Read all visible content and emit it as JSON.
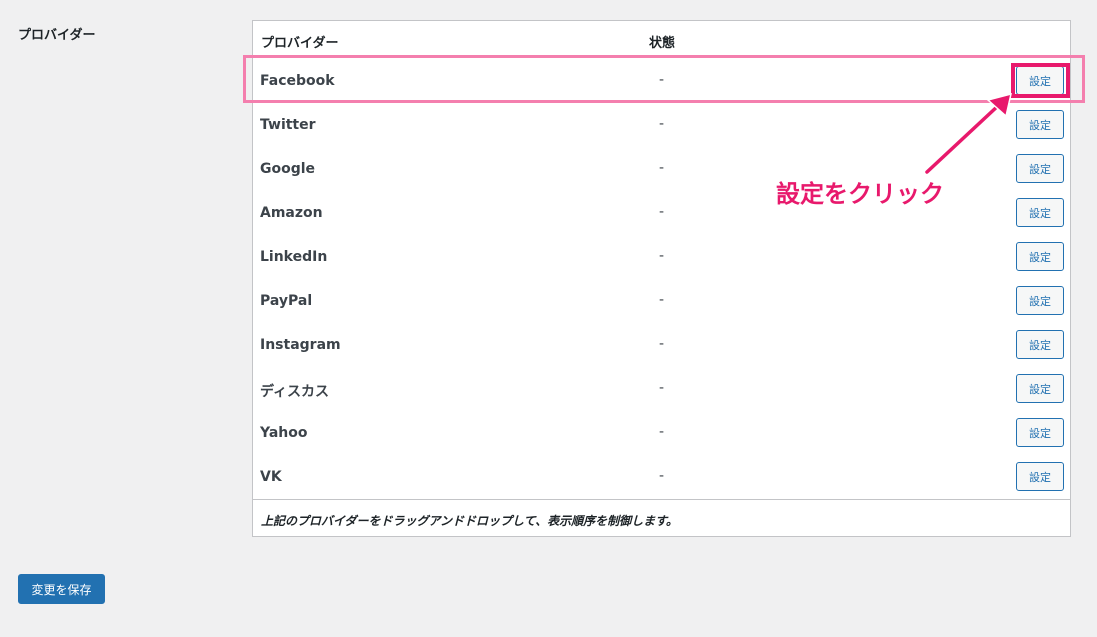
{
  "section_label": "プロバイダー",
  "table": {
    "headers": {
      "provider": "プロバイダー",
      "status": "状態"
    },
    "rows": [
      {
        "name": "Facebook",
        "status": "-",
        "button": "設定"
      },
      {
        "name": "Twitter",
        "status": "-",
        "button": "設定"
      },
      {
        "name": "Google",
        "status": "-",
        "button": "設定"
      },
      {
        "name": "Amazon",
        "status": "-",
        "button": "設定"
      },
      {
        "name": "LinkedIn",
        "status": "-",
        "button": "設定"
      },
      {
        "name": "PayPal",
        "status": "-",
        "button": "設定"
      },
      {
        "name": "Instagram",
        "status": "-",
        "button": "設定"
      },
      {
        "name": "ディスカス",
        "status": "-",
        "button": "設定"
      },
      {
        "name": "Yahoo",
        "status": "-",
        "button": "設定"
      },
      {
        "name": "VK",
        "status": "-",
        "button": "設定"
      }
    ],
    "footer_note": "上記のプロバイダーをドラッグアンドドロップして、表示順序を制御します。"
  },
  "annotation": {
    "callout": "設定をクリック",
    "color": "#e8196c",
    "row_highlight_color": "#f47fae"
  },
  "save_button": "変更を保存",
  "colors": {
    "background": "#f0f0f1",
    "primary": "#2271b1"
  }
}
